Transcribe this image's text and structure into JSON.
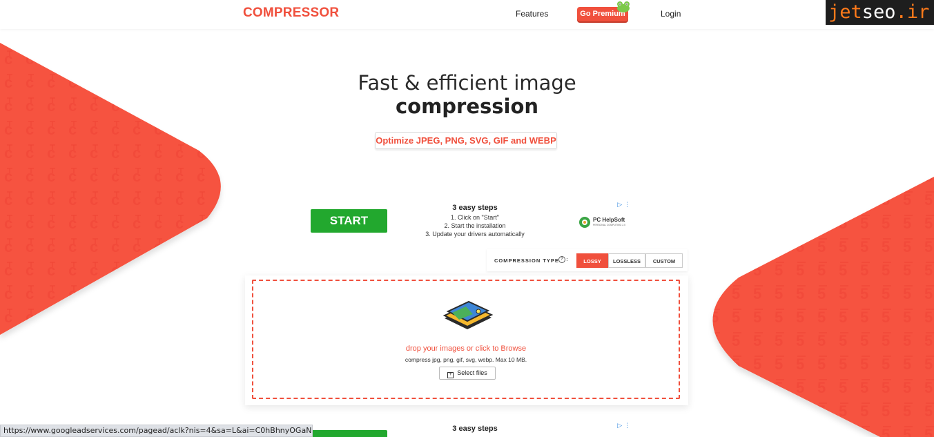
{
  "brand": {
    "logo_text": "COMPRESSOR",
    "accent": "#f0503d"
  },
  "nav": {
    "features": "Features",
    "premium": "Go Premium",
    "login": "Login"
  },
  "watermark": {
    "jet": "jet",
    "seo": "seo",
    "ir": ".ir"
  },
  "hero": {
    "line1": "Fast & efficient image",
    "line2": "compression",
    "tagline": "Optimize JPEG, PNG, SVG, GIF and WEBP"
  },
  "ad": {
    "start_label": "START",
    "title": "3 easy steps",
    "steps": [
      "1. Click on \"Start\"",
      "2. Start the installation",
      "3. Update your drivers automatically"
    ],
    "advertiser": "PC HelpSoft",
    "advertiser_sub": "PERSONAL COMPUTING 2.0",
    "adchoices_icon": "adchoices-icon"
  },
  "compression_type": {
    "label": "COMPRESSION TYPE",
    "help_icon": "help-circle-icon",
    "options": [
      "LOSSY",
      "LOSSLESS",
      "CUSTOM"
    ],
    "selected": "LOSSY"
  },
  "dropzone": {
    "main": "drop your images or click to Browse",
    "sub": "compress jpg, png, gif, svg, webp. Max 10 MB.",
    "button": "Select files"
  },
  "ad2": {
    "title": "3 easy steps"
  },
  "status_url": "https://www.googleadservices.com/pagead/aclk?nis=4&sa=L&ai=C0hBhnyOGaN..."
}
